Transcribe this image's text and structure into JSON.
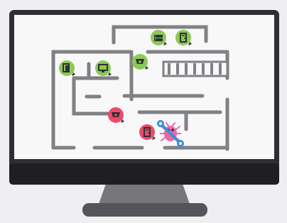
{
  "colors": {
    "background": "#efeff1",
    "monitor_frame": "#2f2f33",
    "monitor_bezel": "#1f1f22",
    "screen": "#f8f8f9",
    "wall": "#808085",
    "stand": "#77777b",
    "base": "#54545a",
    "badge_green": "#8cc857",
    "badge_pink": "#eb4b6b",
    "wrench": "#3a8fd8",
    "bug": "#e76aa6"
  },
  "floor_plan": {
    "devices": [
      {
        "name": "server-device-icon",
        "status": "ok",
        "glyph": "server"
      },
      {
        "name": "door-device-icon",
        "status": "ok",
        "glyph": "door"
      },
      {
        "name": "pc-device-icon",
        "status": "ok",
        "glyph": "pc"
      },
      {
        "name": "monitor-device-icon",
        "status": "ok",
        "glyph": "monitor"
      },
      {
        "name": "camera-device-icon",
        "status": "ok",
        "glyph": "camera"
      },
      {
        "name": "camera-alert-device-icon",
        "status": "alert",
        "glyph": "camera"
      },
      {
        "name": "door-alert-device-icon",
        "status": "alert",
        "glyph": "door"
      }
    ],
    "repair_indicator": "bug-with-wrench-icon"
  }
}
